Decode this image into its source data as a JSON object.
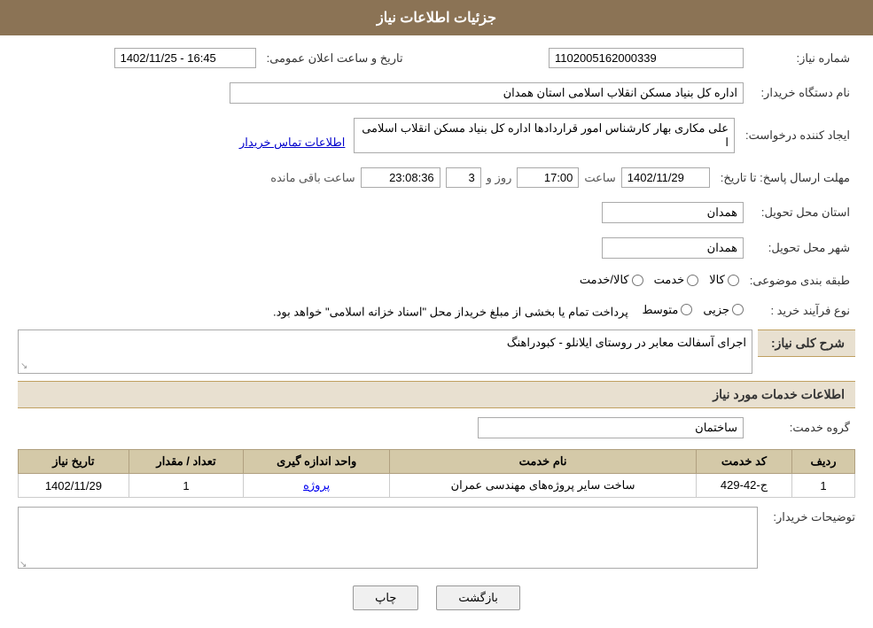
{
  "header": {
    "title": "جزئیات اطلاعات نیاز"
  },
  "fields": {
    "shomareNiaz_label": "شماره نیاز:",
    "shomareNiaz_value": "1102005162000339",
    "namDastgah_label": "نام دستگاه خریدار:",
    "namDastgah_value": "اداره کل بنیاد مسکن انقلاب اسلامی استان همدان",
    "ijadKonande_label": "ایجاد کننده درخواست:",
    "ijadKonande_value": "علی مکاری بهار کارشناس امور قراردادها اداره کل بنیاد مسکن انقلاب اسلامی ا",
    "etelaat_link": "اطلاعات تماس خریدار",
    "mohlat_label": "مهلت ارسال پاسخ: تا تاریخ:",
    "date_value": "1402/11/29",
    "time_label": "ساعت",
    "time_value": "17:00",
    "rooz_label": "روز و",
    "rooz_value": "3",
    "remaining_label": "ساعت باقی مانده",
    "remaining_value": "23:08:36",
    "tarikhoSaat_label": "تاریخ و ساعت اعلان عمومی:",
    "tarikhoSaat_value": "1402/11/25 - 16:45",
    "ostan_label": "استان محل تحویل:",
    "ostan_value": "همدان",
    "shahr_label": "شهر محل تحویل:",
    "shahr_value": "همدان",
    "tabaghe_label": "طبقه بندی موضوعی:",
    "tabaghe_kala": "کالا",
    "tabaghe_khedmat": "خدمت",
    "tabaghe_kalakhedmat": "کالا/خدمت",
    "naveFarayand_label": "نوع فرآیند خرید :",
    "naveFarayand_jazee": "جزیی",
    "naveFarayand_motevaset": "متوسط",
    "naveFarayand_description": "پرداخت تمام یا بخشی از مبلغ خریداز محل \"اسناد خزانه اسلامی\" خواهد بود.",
    "sharh_label": "شرح کلی نیاز:",
    "sharh_value": "اجرای آسفالت معابر در روستای ایلانلو - کبودراهنگ",
    "services_section": "اطلاعات خدمات مورد نیاز",
    "grooh_label": "گروه خدمت:",
    "grooh_value": "ساختمان",
    "table": {
      "headers": [
        "ردیف",
        "کد خدمت",
        "نام خدمت",
        "واحد اندازه گیری",
        "تعداد / مقدار",
        "تاریخ نیاز"
      ],
      "rows": [
        {
          "radif": "1",
          "kod": "ج-42-429",
          "nam": "ساخت سایر پروژه‌های مهندسی عمران",
          "vahed": "پروژه",
          "tedad": "1",
          "tarikh": "1402/11/29"
        }
      ]
    },
    "toseeh_label": "توضیحات خریدار:",
    "toseeh_value": "",
    "btn_chap": "چاپ",
    "btn_bazgasht": "بازگشت"
  }
}
